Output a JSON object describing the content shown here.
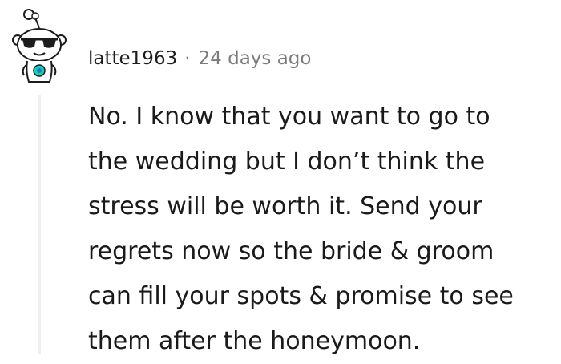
{
  "comment": {
    "author": "latte1963",
    "separator": "·",
    "timestamp": "24 days ago",
    "avatar_icon": "snoo-sunglasses-avatar-icon",
    "body_lines": [
      "No. I know that you want to go to",
      "the wedding but I don’t think the",
      "stress will be worth it. Send your",
      "regrets now so the bride & groom",
      "can fill your spots & promise to see",
      "them after the honeymoon."
    ]
  },
  "colors": {
    "text": "#1a1a1b",
    "meta": "#7c7c7c",
    "thread_line": "#edeff1",
    "avatar_accent": "#0dd3bb"
  }
}
